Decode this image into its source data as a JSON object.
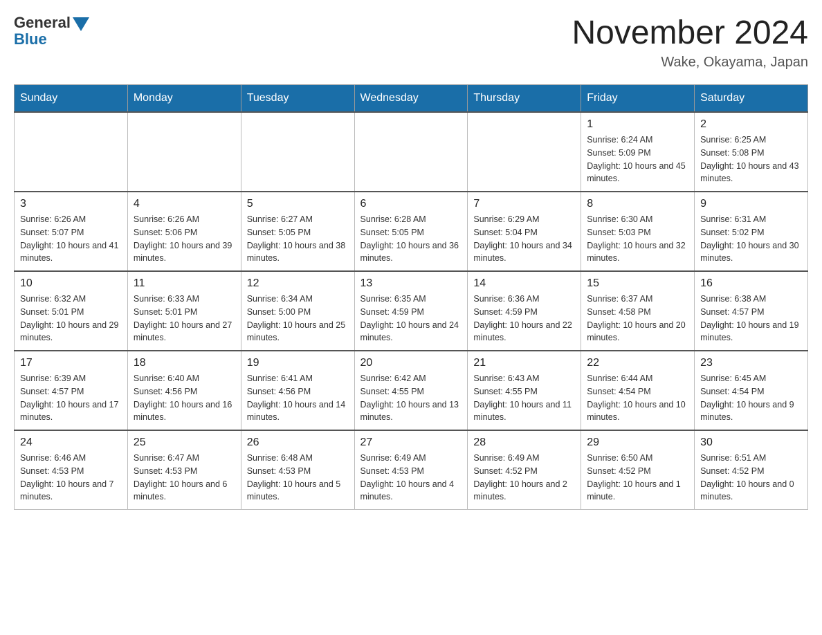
{
  "header": {
    "logo_general": "General",
    "logo_blue": "Blue",
    "month_title": "November 2024",
    "location": "Wake, Okayama, Japan"
  },
  "days_of_week": [
    "Sunday",
    "Monday",
    "Tuesday",
    "Wednesday",
    "Thursday",
    "Friday",
    "Saturday"
  ],
  "weeks": [
    [
      {
        "day": "",
        "info": ""
      },
      {
        "day": "",
        "info": ""
      },
      {
        "day": "",
        "info": ""
      },
      {
        "day": "",
        "info": ""
      },
      {
        "day": "",
        "info": ""
      },
      {
        "day": "1",
        "info": "Sunrise: 6:24 AM\nSunset: 5:09 PM\nDaylight: 10 hours and 45 minutes."
      },
      {
        "day": "2",
        "info": "Sunrise: 6:25 AM\nSunset: 5:08 PM\nDaylight: 10 hours and 43 minutes."
      }
    ],
    [
      {
        "day": "3",
        "info": "Sunrise: 6:26 AM\nSunset: 5:07 PM\nDaylight: 10 hours and 41 minutes."
      },
      {
        "day": "4",
        "info": "Sunrise: 6:26 AM\nSunset: 5:06 PM\nDaylight: 10 hours and 39 minutes."
      },
      {
        "day": "5",
        "info": "Sunrise: 6:27 AM\nSunset: 5:05 PM\nDaylight: 10 hours and 38 minutes."
      },
      {
        "day": "6",
        "info": "Sunrise: 6:28 AM\nSunset: 5:05 PM\nDaylight: 10 hours and 36 minutes."
      },
      {
        "day": "7",
        "info": "Sunrise: 6:29 AM\nSunset: 5:04 PM\nDaylight: 10 hours and 34 minutes."
      },
      {
        "day": "8",
        "info": "Sunrise: 6:30 AM\nSunset: 5:03 PM\nDaylight: 10 hours and 32 minutes."
      },
      {
        "day": "9",
        "info": "Sunrise: 6:31 AM\nSunset: 5:02 PM\nDaylight: 10 hours and 30 minutes."
      }
    ],
    [
      {
        "day": "10",
        "info": "Sunrise: 6:32 AM\nSunset: 5:01 PM\nDaylight: 10 hours and 29 minutes."
      },
      {
        "day": "11",
        "info": "Sunrise: 6:33 AM\nSunset: 5:01 PM\nDaylight: 10 hours and 27 minutes."
      },
      {
        "day": "12",
        "info": "Sunrise: 6:34 AM\nSunset: 5:00 PM\nDaylight: 10 hours and 25 minutes."
      },
      {
        "day": "13",
        "info": "Sunrise: 6:35 AM\nSunset: 4:59 PM\nDaylight: 10 hours and 24 minutes."
      },
      {
        "day": "14",
        "info": "Sunrise: 6:36 AM\nSunset: 4:59 PM\nDaylight: 10 hours and 22 minutes."
      },
      {
        "day": "15",
        "info": "Sunrise: 6:37 AM\nSunset: 4:58 PM\nDaylight: 10 hours and 20 minutes."
      },
      {
        "day": "16",
        "info": "Sunrise: 6:38 AM\nSunset: 4:57 PM\nDaylight: 10 hours and 19 minutes."
      }
    ],
    [
      {
        "day": "17",
        "info": "Sunrise: 6:39 AM\nSunset: 4:57 PM\nDaylight: 10 hours and 17 minutes."
      },
      {
        "day": "18",
        "info": "Sunrise: 6:40 AM\nSunset: 4:56 PM\nDaylight: 10 hours and 16 minutes."
      },
      {
        "day": "19",
        "info": "Sunrise: 6:41 AM\nSunset: 4:56 PM\nDaylight: 10 hours and 14 minutes."
      },
      {
        "day": "20",
        "info": "Sunrise: 6:42 AM\nSunset: 4:55 PM\nDaylight: 10 hours and 13 minutes."
      },
      {
        "day": "21",
        "info": "Sunrise: 6:43 AM\nSunset: 4:55 PM\nDaylight: 10 hours and 11 minutes."
      },
      {
        "day": "22",
        "info": "Sunrise: 6:44 AM\nSunset: 4:54 PM\nDaylight: 10 hours and 10 minutes."
      },
      {
        "day": "23",
        "info": "Sunrise: 6:45 AM\nSunset: 4:54 PM\nDaylight: 10 hours and 9 minutes."
      }
    ],
    [
      {
        "day": "24",
        "info": "Sunrise: 6:46 AM\nSunset: 4:53 PM\nDaylight: 10 hours and 7 minutes."
      },
      {
        "day": "25",
        "info": "Sunrise: 6:47 AM\nSunset: 4:53 PM\nDaylight: 10 hours and 6 minutes."
      },
      {
        "day": "26",
        "info": "Sunrise: 6:48 AM\nSunset: 4:53 PM\nDaylight: 10 hours and 5 minutes."
      },
      {
        "day": "27",
        "info": "Sunrise: 6:49 AM\nSunset: 4:53 PM\nDaylight: 10 hours and 4 minutes."
      },
      {
        "day": "28",
        "info": "Sunrise: 6:49 AM\nSunset: 4:52 PM\nDaylight: 10 hours and 2 minutes."
      },
      {
        "day": "29",
        "info": "Sunrise: 6:50 AM\nSunset: 4:52 PM\nDaylight: 10 hours and 1 minute."
      },
      {
        "day": "30",
        "info": "Sunrise: 6:51 AM\nSunset: 4:52 PM\nDaylight: 10 hours and 0 minutes."
      }
    ]
  ]
}
